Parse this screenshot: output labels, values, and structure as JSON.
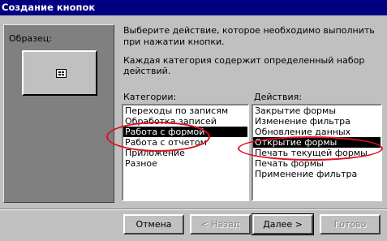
{
  "window": {
    "title": "Создание кнопок"
  },
  "preview": {
    "label": "Образец:",
    "icon": "form-icon"
  },
  "description": {
    "line1": "Выберите действие, которое необходимо выполнить при нажатии кнопки.",
    "line2": "Каждая категория содержит определенный набор действий."
  },
  "categories": {
    "label": "Категории:",
    "items": [
      "Переходы по записям",
      "Обработка записей",
      "Работа с формой",
      "Работа с отчетом",
      "Приложение",
      "Разное"
    ],
    "selected": "Работа с формой"
  },
  "actions": {
    "label": "Действия:",
    "items": [
      "Закрытие формы",
      "Изменение фильтра",
      "Обновление данных",
      "Открытие формы",
      "Печать текущей формы",
      "Печать формы",
      "Применение фильтра"
    ],
    "selected": "Открытие формы"
  },
  "buttons": {
    "cancel": "Отмена",
    "back": "< Назад",
    "next": "Далее >",
    "finish": "Готово"
  },
  "annotation_color": "#e01020"
}
